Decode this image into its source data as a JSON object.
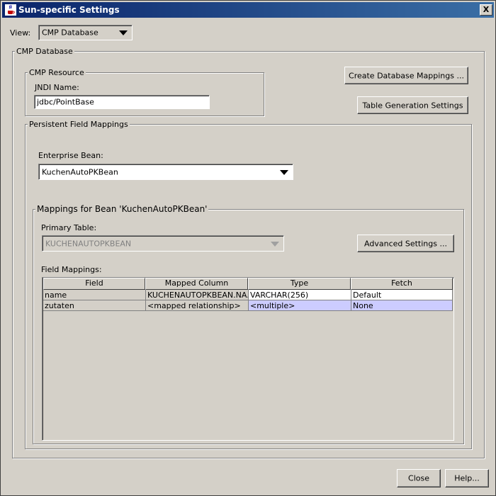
{
  "window": {
    "title": "Sun-specific Settings",
    "close_glyph": "X"
  },
  "view": {
    "label": "View:",
    "selected": "CMP Database"
  },
  "cmp_database": {
    "legend": "CMP Database"
  },
  "cmp_resource": {
    "legend": "CMP Resource",
    "jndi_label": "JNDI Name:",
    "jndi_value": "jdbc/PointBase"
  },
  "buttons": {
    "create_mappings": "Create Database Mappings ...",
    "table_generation": "Table Generation Settings",
    "advanced": "Advanced Settings ...",
    "close": "Close",
    "help": "Help..."
  },
  "persistent": {
    "legend": "Persistent Field Mappings",
    "enterprise_bean_label": "Enterprise Bean:",
    "enterprise_bean_selected": "KuchenAutoPKBean"
  },
  "mappings": {
    "legend": "Mappings for Bean 'KuchenAutoPKBean'",
    "primary_table_label": "Primary Table:",
    "primary_table_selected": "KUCHENAUTOPKBEAN",
    "field_mappings_label": "Field Mappings:"
  },
  "table": {
    "columns": [
      "Field",
      "Mapped Column",
      "Type",
      "Fetch"
    ],
    "rows": [
      [
        "name",
        "KUCHENAUTOPKBEAN.NA...",
        "VARCHAR(256)",
        "Default"
      ],
      [
        "zutaten",
        "<mapped relationship>",
        "<multiple>",
        "None"
      ]
    ]
  },
  "colors": {
    "title_start": "#0a246a",
    "title_end": "#3a6ea5",
    "selected_row": "#ccccff",
    "read_only_cell": "#d4d0c8"
  }
}
